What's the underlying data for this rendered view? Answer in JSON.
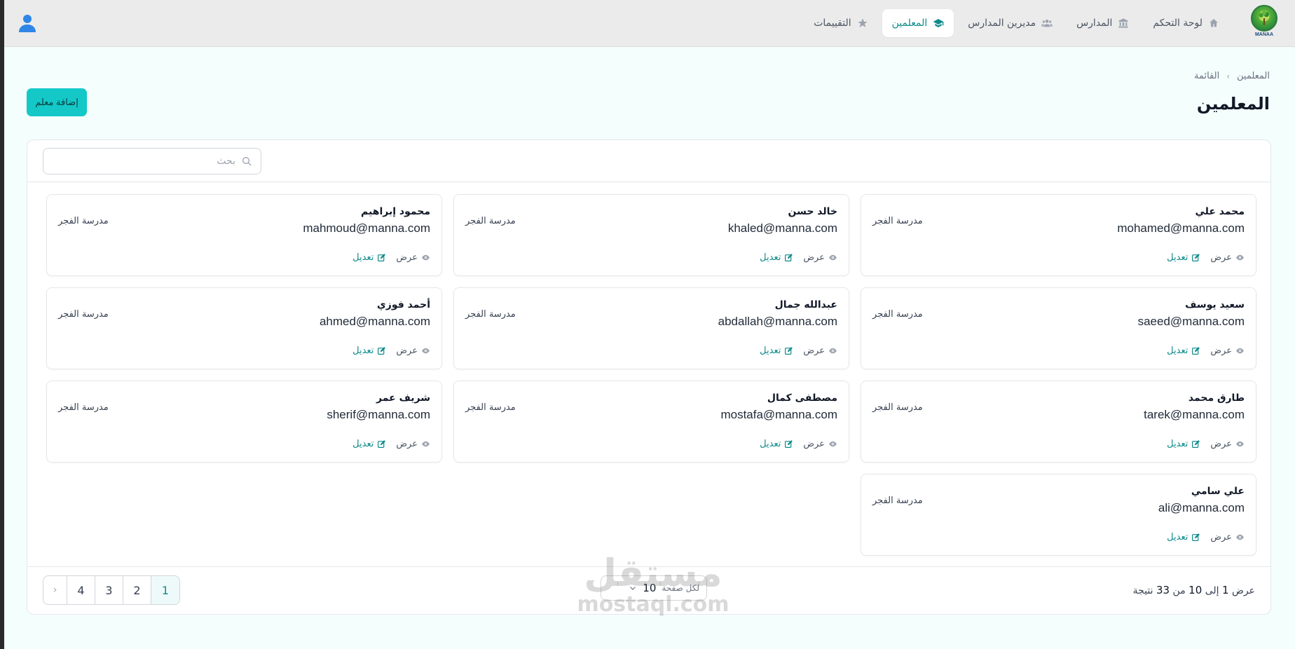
{
  "logo": {
    "text": "MANAA"
  },
  "nav": {
    "items": [
      {
        "label": "لوحة التحكم",
        "icon": "home-icon"
      },
      {
        "label": "المدارس",
        "icon": "building-icon"
      },
      {
        "label": "مديرين المدارس",
        "icon": "users-icon"
      },
      {
        "label": "المعلمين",
        "icon": "graduation-cap-icon",
        "active": true
      },
      {
        "label": "التقييمات",
        "icon": "star-icon"
      }
    ]
  },
  "breadcrumb": {
    "root": "المعلمين",
    "current": "القائمة"
  },
  "page": {
    "title": "المعلمين",
    "add_button": "إضافة معلم"
  },
  "search": {
    "placeholder": "بحث"
  },
  "actions": {
    "view": "عرض",
    "edit": "تعديل"
  },
  "teachers": [
    {
      "name": "محمد علي",
      "email": "mohamed@manna.com",
      "school": "مدرسة الفجر"
    },
    {
      "name": "خالد حسن",
      "email": "khaled@manna.com",
      "school": "مدرسة الفجر"
    },
    {
      "name": "محمود إبراهيم",
      "email": "mahmoud@manna.com",
      "school": "مدرسة الفجر"
    },
    {
      "name": "سعيد يوسف",
      "email": "saeed@manna.com",
      "school": "مدرسة الفجر"
    },
    {
      "name": "عبدالله جمال",
      "email": "abdallah@manna.com",
      "school": "مدرسة الفجر"
    },
    {
      "name": "أحمد فوزي",
      "email": "ahmed@manna.com",
      "school": "مدرسة الفجر"
    },
    {
      "name": "طارق محمد",
      "email": "tarek@manna.com",
      "school": "مدرسة الفجر"
    },
    {
      "name": "مصطفى كمال",
      "email": "mostafa@manna.com",
      "school": "مدرسة الفجر"
    },
    {
      "name": "شريف عمر",
      "email": "sherif@manna.com",
      "school": "مدرسة الفجر"
    },
    {
      "name": "علي سامي",
      "email": "ali@manna.com",
      "school": "مدرسة الفجر"
    }
  ],
  "footer": {
    "result_prefix": "عرض",
    "from": "1",
    "to_word": "إلى",
    "to": "10",
    "of_word": "من",
    "total": "33",
    "result_suffix": "نتيجة",
    "per_page_label": "لكل صفحة",
    "per_page_value": "10",
    "pages": [
      "1",
      "2",
      "3",
      "4"
    ],
    "current_page": "1"
  },
  "watermark": {
    "arabic": "مستقل",
    "latin": "mostaql.com"
  },
  "colors": {
    "accent": "#0e8a8a",
    "button": "#14c8c8",
    "background": "#f4fefd"
  }
}
